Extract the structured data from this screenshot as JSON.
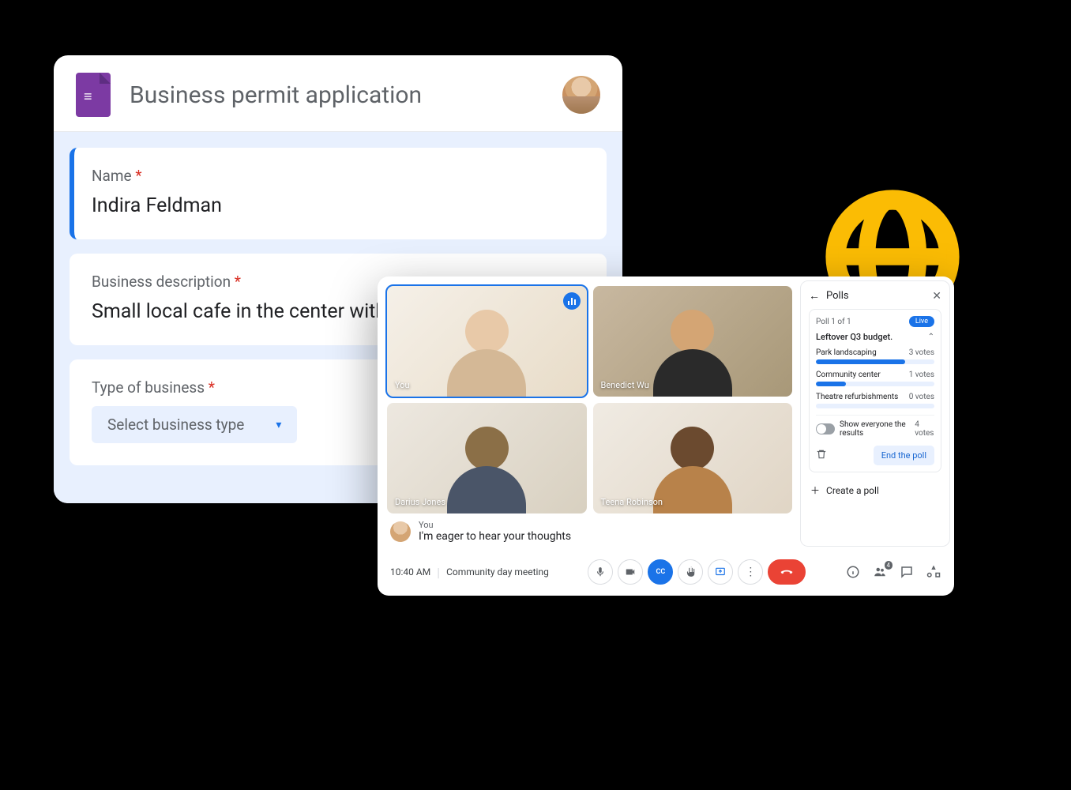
{
  "forms": {
    "title": "Business permit application",
    "questions": {
      "name": {
        "label": "Name",
        "value": "Indira Feldman"
      },
      "desc": {
        "label": "Business description",
        "value": "Small local cafe in the center with an onsite bakery."
      },
      "type": {
        "label": "Type of business",
        "placeholder": "Select business type"
      }
    }
  },
  "meet": {
    "time": "10:40 AM",
    "meeting_name": "Community day meeting",
    "participant_count": "4",
    "tiles": {
      "you": "You",
      "p2": "Benedict Wu",
      "p3": "Darius Jones",
      "p4": "Teena Robinson"
    },
    "caption": {
      "speaker": "You",
      "text": "I'm eager to hear your thoughts"
    },
    "cc_label": "CC"
  },
  "polls": {
    "title": "Polls",
    "counter": "Poll 1 of 1",
    "live": "Live",
    "question": "Leftover Q3 budget.",
    "options": [
      {
        "name": "Park landscaping",
        "votes": "3 votes",
        "pct": 75
      },
      {
        "name": "Community center",
        "votes": "1 votes",
        "pct": 25
      },
      {
        "name": "Theatre refurbishments",
        "votes": "0 votes",
        "pct": 0
      }
    ],
    "show_results": "Show everyone the results",
    "total_votes": "4 votes",
    "end_poll": "End the poll",
    "create": "Create a poll"
  }
}
